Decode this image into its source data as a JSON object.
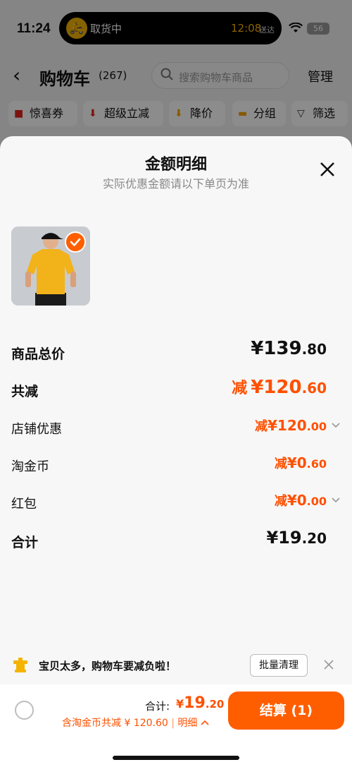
{
  "status_bar": {
    "time": "11:24",
    "island_label": "取货中",
    "island_time": "12:08",
    "island_sub": "送达",
    "battery": "56"
  },
  "nav": {
    "title": "购物车",
    "count": "(267)",
    "search_placeholder": "搜索购物车商品",
    "manage": "管理"
  },
  "filters": [
    {
      "label": "惊喜券",
      "icon": "coupon-icon"
    },
    {
      "label": "超级立减",
      "icon": "down-arrow-icon"
    },
    {
      "label": "降价",
      "icon": "price-drop-icon"
    },
    {
      "label": "分组",
      "icon": "folder-icon"
    },
    {
      "label": "筛选",
      "icon": "filter-icon"
    }
  ],
  "sheet": {
    "title": "金额明细",
    "subtitle": "实际优惠金额请以下单页为准"
  },
  "rows": {
    "subtotal": {
      "label": "商品总价",
      "currency": "¥",
      "int": "139",
      "dec": ".80"
    },
    "total_discount": {
      "label": "共减",
      "prefix": "减",
      "currency": "¥",
      "int": "120",
      "dec": ".60"
    },
    "store_discount": {
      "label": "店铺优惠",
      "prefix": "减",
      "currency": "¥",
      "int": "120",
      "dec": ".00"
    },
    "taojinbi": {
      "label": "淘金币",
      "prefix": "减",
      "currency": "¥",
      "int": "0",
      "dec": ".60"
    },
    "red_packet": {
      "label": "红包",
      "prefix": "减",
      "currency": "¥",
      "int": "0",
      "dec": ".00"
    },
    "total": {
      "label": "合计",
      "currency": "¥",
      "int": "19",
      "dec": ".20"
    }
  },
  "tip": {
    "text": "宝贝太多，购物车要减负啦！",
    "batch_clear": "批量清理"
  },
  "checkout": {
    "total_label": "合计:",
    "currency": "¥",
    "int": "19",
    "dec": ".20",
    "saving_text": "含淘金币共减 ¥ 120.60",
    "detail": "明细",
    "pay_label": "结算 (1)"
  },
  "colors": {
    "accent": "#ff5000",
    "button": "#ff5e00"
  }
}
